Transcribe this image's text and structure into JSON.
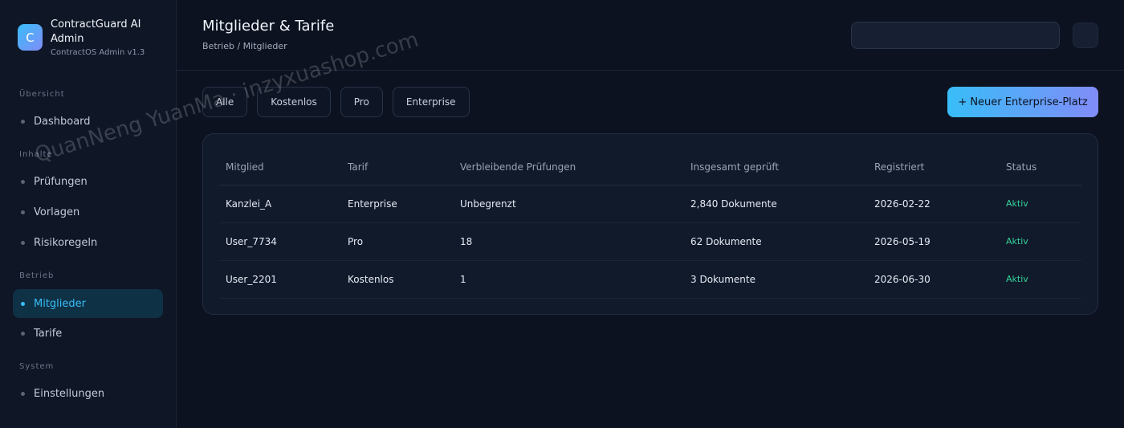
{
  "brand": {
    "logo_letter": "C",
    "title": "ContractGuard AI Admin",
    "subtitle": "ContractOS Admin v1.3"
  },
  "sidebar": {
    "sections": [
      {
        "label": "Übersicht",
        "items": [
          {
            "label": "Dashboard"
          }
        ]
      },
      {
        "label": "Inhalte",
        "items": [
          {
            "label": "Prüfungen"
          },
          {
            "label": "Vorlagen"
          },
          {
            "label": "Risikoregeln"
          }
        ]
      },
      {
        "label": "Betrieb",
        "items": [
          {
            "label": "Mitglieder",
            "active": true
          },
          {
            "label": "Tarife"
          }
        ]
      },
      {
        "label": "System",
        "items": [
          {
            "label": "Einstellungen"
          }
        ]
      }
    ]
  },
  "header": {
    "title": "Mitglieder & Tarife",
    "breadcrumb": "Betrieb / Mitglieder",
    "search_value": ""
  },
  "filters": [
    "Alle",
    "Kostenlos",
    "Pro",
    "Enterprise"
  ],
  "primary_action": "+ Neuer Enterprise-Platz",
  "table": {
    "columns": [
      "Mitglied",
      "Tarif",
      "Verbleibende Prüfungen",
      "Insgesamt geprüft",
      "Registriert",
      "Status"
    ],
    "rows": [
      [
        "Kanzlei_A",
        "Enterprise",
        "Unbegrenzt",
        "2,840 Dokumente",
        "2026-02-22",
        "Aktiv"
      ],
      [
        "User_7734",
        "Pro",
        "18",
        "62 Dokumente",
        "2026-05-19",
        "Aktiv"
      ],
      [
        "User_2201",
        "Kostenlos",
        "1",
        "3 Dokumente",
        "2026-06-30",
        "Aktiv"
      ]
    ]
  },
  "watermark": "QuanNeng YuanMa · inzyxuashop.com",
  "colors": {
    "background": "#0c1220",
    "accent": "#38bdf8",
    "accent_gradient_end": "#818cf8",
    "status_active": "#34d399"
  }
}
